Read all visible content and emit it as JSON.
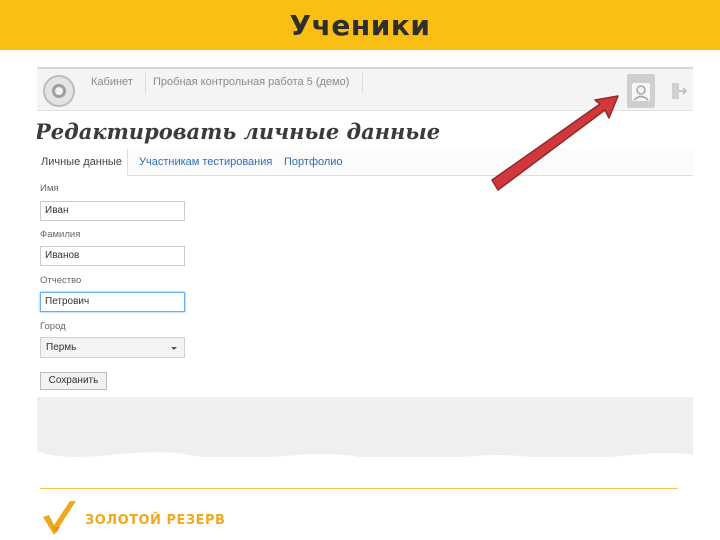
{
  "slide": {
    "title": "Ученики",
    "brand": "ЗОЛОТОЙ РЕЗЕРВ"
  },
  "header": {
    "nav_cabinet": "Кабинет",
    "nav_test": "Пробная контрольная работа 5 (демо)",
    "user_icon": "user-profile-icon",
    "exit_icon": "exit-icon"
  },
  "page": {
    "heading": "Редактировать личные данные"
  },
  "tabs": [
    {
      "label": "Личные данные",
      "active": true
    },
    {
      "label": "Участникам тестирования",
      "active": false
    },
    {
      "label": "Портфолио",
      "active": false
    }
  ],
  "form": {
    "first_name_label": "Имя",
    "first_name_value": "Иван",
    "last_name_label": "Фамилия",
    "last_name_value": "Иванов",
    "patronymic_label": "Отчество",
    "patronymic_value": "Петрович",
    "city_label": "Город",
    "city_value": "Пермь",
    "save_label": "Сохранить"
  },
  "colors": {
    "title_band": "#f9bf14",
    "arrow": "#d2373b",
    "link": "#2f6db3",
    "brand": "#f2a81c"
  }
}
